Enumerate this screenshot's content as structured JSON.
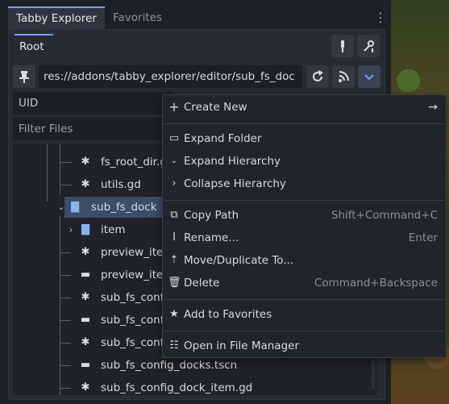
{
  "tabs": [
    {
      "label": "Tabby Explorer",
      "active": true
    },
    {
      "label": "Favorites",
      "active": false
    }
  ],
  "root_tab": {
    "label": "Root"
  },
  "path": {
    "value": "res://addons/tabby_explorer/editor/sub_fs_doc"
  },
  "uid_field": {
    "value": "UID"
  },
  "filter_field": {
    "placeholder": "Filter Files"
  },
  "tree": {
    "rows": [
      {
        "label": "fs_root_dir.g",
        "icon": "gear-icon"
      },
      {
        "label": "utils.gd",
        "icon": "gear-icon"
      },
      {
        "label": "sub_fs_dock",
        "icon": "folder-icon"
      },
      {
        "label": "item",
        "icon": "folder-icon"
      },
      {
        "label": "preview_iter",
        "icon": "gear-icon"
      },
      {
        "label": "preview_iter",
        "icon": "scene-icon"
      },
      {
        "label": "sub_fs_confi",
        "icon": "gear-icon"
      },
      {
        "label": "sub_fs_confi",
        "icon": "scene-icon"
      },
      {
        "label": "sub_fs_confi",
        "icon": "gear-icon"
      },
      {
        "label": "sub_fs_config_docks.tscn",
        "icon": "scene-icon"
      },
      {
        "label": "sub_fs_config_dock_item.gd",
        "icon": "gear-icon"
      }
    ]
  },
  "menu": {
    "create_new": "Create New",
    "expand_folder": "Expand Folder",
    "expand_hierarchy": "Expand Hierarchy",
    "collapse_hierarchy": "Collapse Hierarchy",
    "copy_path": "Copy Path",
    "copy_path_shortcut": "Shift+Command+C",
    "rename": "Rename...",
    "rename_shortcut": "Enter",
    "move_duplicate": "Move/Duplicate To...",
    "delete": "Delete",
    "delete_shortcut": "Command+Backspace",
    "add_favorites": "Add to Favorites",
    "open_file_manager": "Open in File Manager"
  },
  "colors": {
    "accent": "#6fa3ff",
    "folder": "#8ab4ee",
    "selection": "#3a4d69"
  }
}
